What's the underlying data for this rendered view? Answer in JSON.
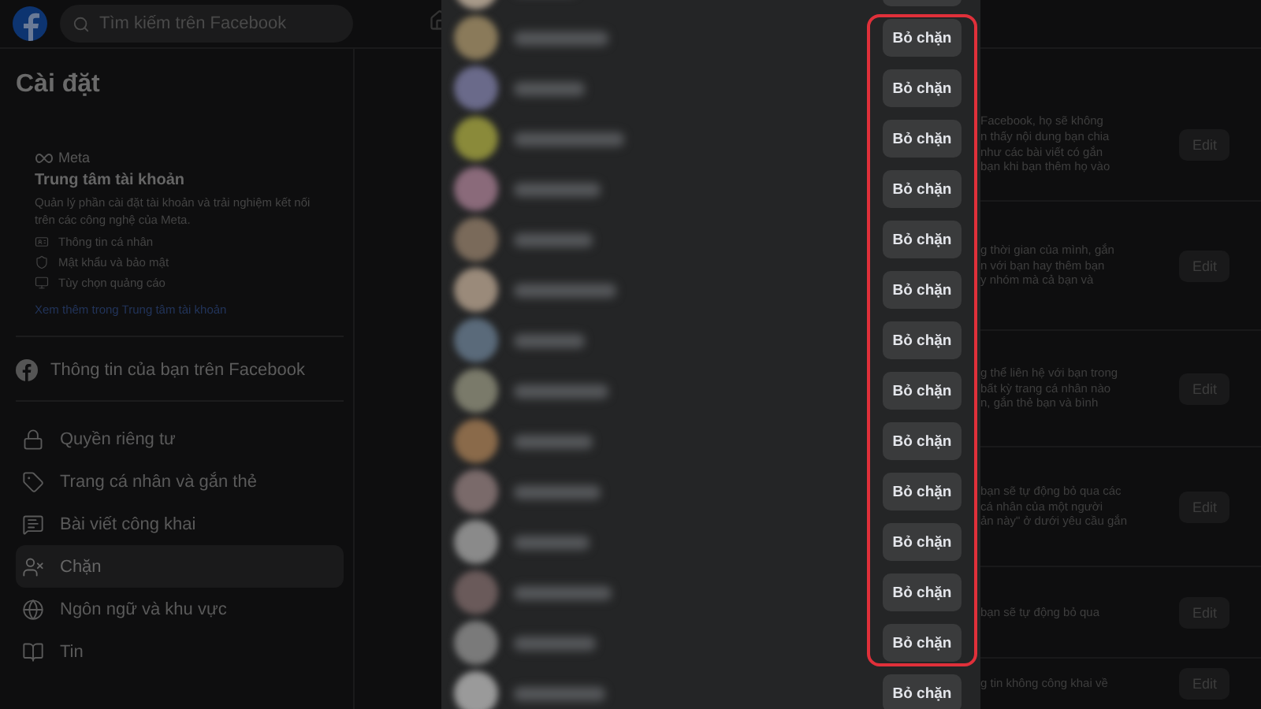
{
  "topbar": {
    "search": {
      "placeholder": "Tìm kiếm trên Facebook"
    }
  },
  "sidebar": {
    "title": "Cài đặt",
    "accounts_center": {
      "brand": "Meta",
      "title": "Trung tâm tài khoản",
      "description": "Quản lý phần cài đặt tài khoản và trải nghiệm kết nối trên các công nghệ của Meta.",
      "items": [
        {
          "kind": "id",
          "label": "Thông tin cá nhân"
        },
        {
          "kind": "shield",
          "label": "Mật khẩu và bảo mật"
        },
        {
          "kind": "ad",
          "label": "Tùy chọn quảng cáo"
        }
      ],
      "link": "Xem thêm trong Trung tâm tài khoản"
    },
    "facebook_info": "Thông tin của bạn trên Facebook",
    "items": [
      {
        "kind": "lock",
        "label": "Quyền riêng tư",
        "selected": false
      },
      {
        "kind": "tag",
        "label": "Trang cá nhân và gắn thẻ",
        "selected": false
      },
      {
        "kind": "post",
        "label": "Bài viết công khai",
        "selected": false
      },
      {
        "kind": "block",
        "label": "Chặn",
        "selected": true
      },
      {
        "kind": "globe",
        "label": "Ngôn ngữ và khu vực",
        "selected": false
      },
      {
        "kind": "book",
        "label": "Tin",
        "selected": false
      }
    ]
  },
  "content": {
    "sections": [
      {
        "lines": [
          "Facebook, họ sẽ không",
          "n thấy nội dung bạn chia",
          "như các bài viết có gắn",
          "bạn khi bạn thêm họ vào"
        ],
        "button": "Edit"
      },
      {
        "lines": [
          "g thời gian của mình, gắn",
          "n với bạn hay thêm bạn",
          "y nhóm mà cả bạn và"
        ],
        "button": "Edit"
      },
      {
        "lines": [
          "g thể liên hệ với bạn trong",
          "bất kỳ trang cá nhân nào",
          "n, gắn thẻ bạn và bình"
        ],
        "button": "Edit"
      },
      {
        "lines": [
          "bạn sẽ tự động bỏ qua các",
          "cá nhân của một người",
          "ản này\" ở dưới yêu cầu gắn"
        ],
        "button": "Edit"
      },
      {
        "lines": [
          "bạn sẽ tự động bỏ qua"
        ],
        "button": "Edit"
      },
      {
        "lines": [
          "g tin không công khai về"
        ],
        "button": "Edit"
      }
    ]
  },
  "blocked_list": {
    "rows": [
      {
        "color": "#a89a8a"
      },
      {
        "button": "Bỏ chặn",
        "color": "#8a7a5a"
      },
      {
        "button": "Bỏ chặn",
        "color": "#6a6a8a"
      },
      {
        "button": "Bỏ chặn",
        "color": "#8a8a3a"
      },
      {
        "button": "Bỏ chặn",
        "color": "#8a6a7a"
      },
      {
        "button": "Bỏ chặn",
        "color": "#7a6a5a"
      },
      {
        "button": "Bỏ chặn",
        "color": "#9a8a7a"
      },
      {
        "button": "Bỏ chặn",
        "color": "#5a6a7a"
      },
      {
        "button": "Bỏ chặn",
        "color": "#7a7a6a"
      },
      {
        "button": "Bỏ chặn",
        "color": "#8a6a4a"
      },
      {
        "button": "Bỏ chặn",
        "color": "#7a6a6a"
      },
      {
        "button": "Bỏ chặn",
        "color": "#8a8a8a"
      },
      {
        "button": "Bỏ chặn",
        "color": "#6a5a5a"
      },
      {
        "button": "Bỏ chặn",
        "color": "#7a7a7a"
      },
      {
        "button": "Bỏ chặn",
        "color": "#9a9a9a"
      }
    ]
  }
}
